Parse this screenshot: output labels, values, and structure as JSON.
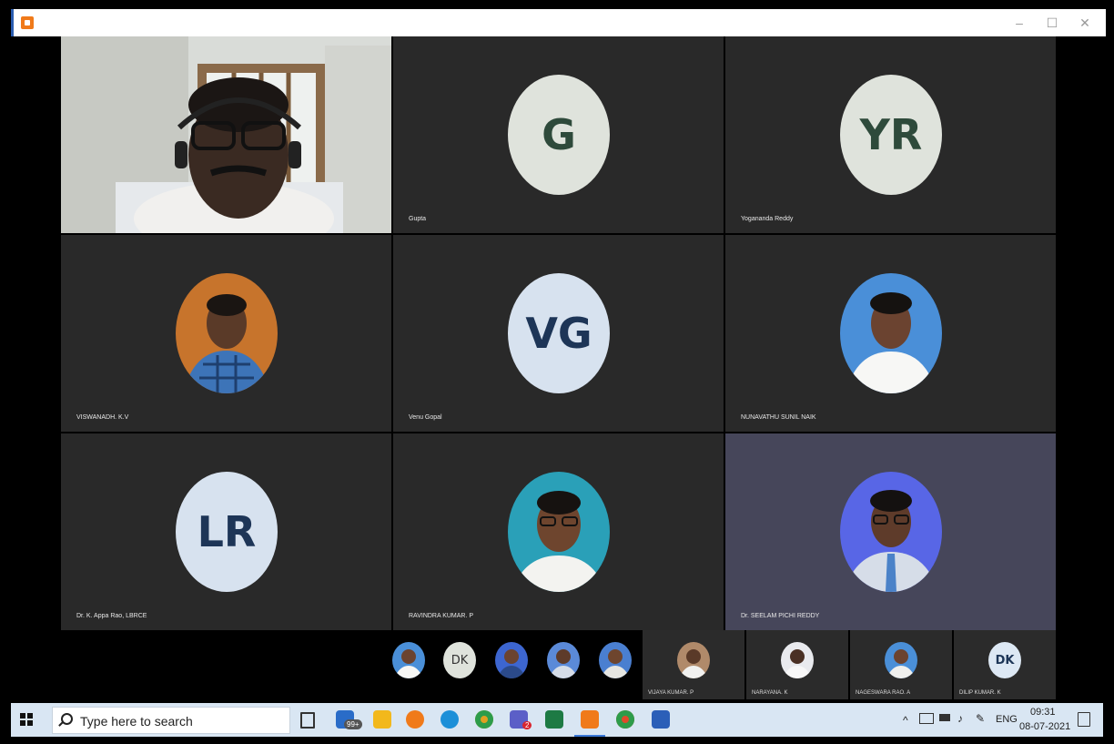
{
  "window": {
    "minimize": "–",
    "maximize": "☐",
    "close": "✕"
  },
  "tiles": [
    {
      "name": "",
      "type": "video"
    },
    {
      "name": "Gupta",
      "initials": "G"
    },
    {
      "name": "Yogananda Reddy",
      "initials": "YR"
    },
    {
      "name": "VISWANADH. K.V",
      "type": "photo"
    },
    {
      "name": "Venu Gopal",
      "initials": "VG"
    },
    {
      "name": "NUNAVATHU SUNIL NAIK",
      "type": "photo"
    },
    {
      "name": "Dr. K. Appa Rao, LBRCE",
      "initials": "LR"
    },
    {
      "name": "RAVINDRA KUMAR. P",
      "type": "photo"
    },
    {
      "name": "Dr. SEELAM PICHI REDDY",
      "type": "photo"
    }
  ],
  "strip": {
    "dk_initials": "DK",
    "named": [
      {
        "name": "VIJAYA KUMAR. P"
      },
      {
        "name": "NARAYANA. K"
      },
      {
        "name": "NAGESWARA RAO. A"
      },
      {
        "name": "DILIP KUMAR. K",
        "initials": "DK"
      }
    ]
  },
  "taskbar": {
    "search_placeholder": "Type here to search",
    "mail_badge": "99+",
    "teams_badge": "2",
    "language": "ENG",
    "time": "09:31",
    "date": "08-07-2021"
  },
  "colors": {
    "highlight_tile": "#46465a",
    "tile": "#292929",
    "taskbar": "#d9e6f3"
  }
}
